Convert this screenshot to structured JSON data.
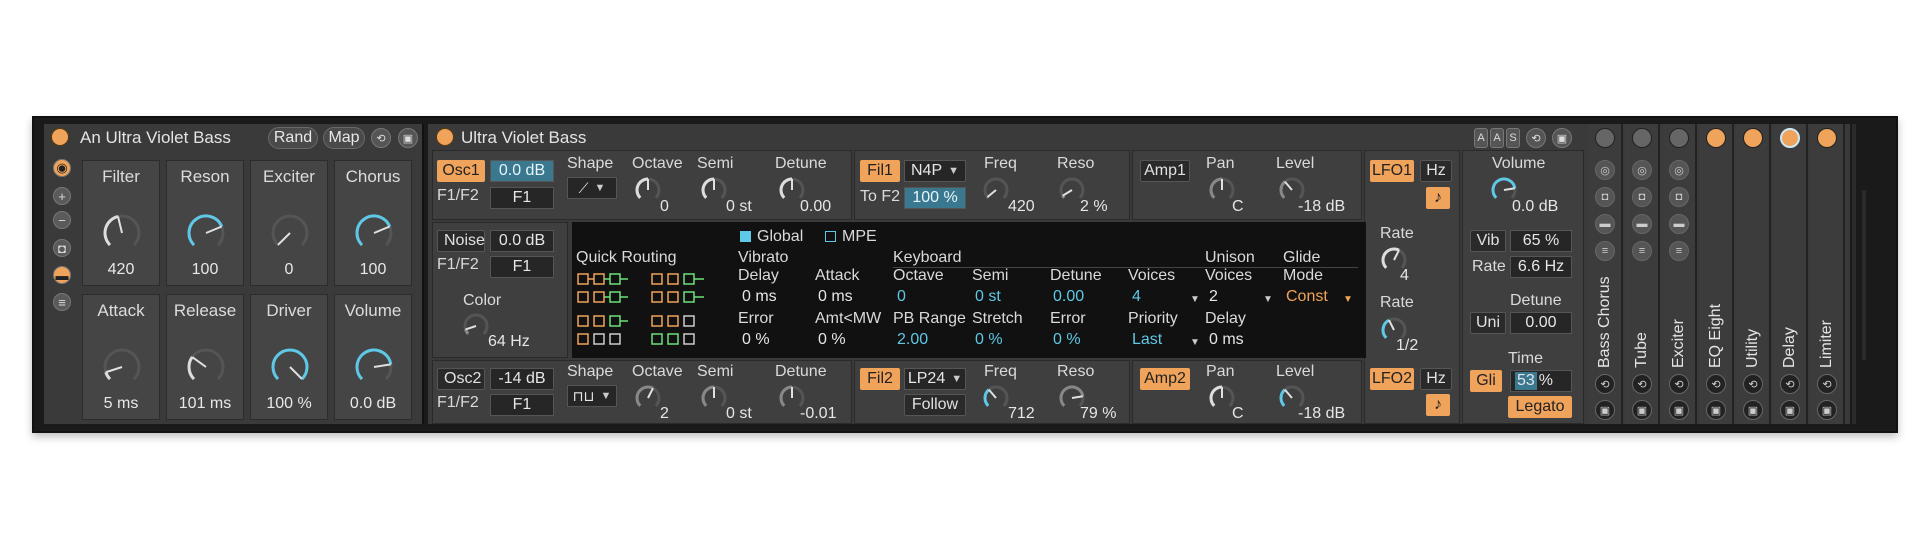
{
  "rack": {
    "title": "An Ultra Violet Bass",
    "rand_label": "Rand",
    "map_label": "Map",
    "macros": [
      {
        "label": "Filter",
        "value": "420",
        "level": 0.45,
        "color": "#dddddd"
      },
      {
        "label": "Reson",
        "value": "100",
        "level": 0.75,
        "color": "#5ec8e6"
      },
      {
        "label": "Exciter",
        "value": "0",
        "level": 0.0,
        "color": "#dddddd"
      },
      {
        "label": "Chorus",
        "value": "100",
        "level": 0.75,
        "color": "#5ec8e6"
      },
      {
        "label": "Attack",
        "value": "5 ms",
        "level": 0.1,
        "color": "#dddddd"
      },
      {
        "label": "Release",
        "value": "101 ms",
        "level": 0.3,
        "color": "#dddddd"
      },
      {
        "label": "Driver",
        "value": "100 %",
        "level": 1.0,
        "color": "#5ec8e6"
      },
      {
        "label": "Volume",
        "value": "0.0 dB",
        "level": 0.8,
        "color": "#5ec8e6"
      }
    ]
  },
  "synth": {
    "title": "Ultra Violet Bass",
    "header_icons": [
      "A",
      "A",
      "S"
    ],
    "osc1": {
      "label": "Osc1",
      "level": "0.0 dB",
      "f1f2_label": "F1/F2",
      "f1f2_value": "F1",
      "shape_label": "Shape",
      "octave_label": "Octave",
      "octave_value": "0",
      "semi_label": "Semi",
      "semi_value": "0 st",
      "detune_label": "Detune",
      "detune_value": "0.00"
    },
    "noise": {
      "label": "Noise",
      "level": "0.0 dB",
      "f1f2_label": "F1/F2",
      "f1f2_value": "F1",
      "color_label": "Color",
      "color_value": "64 Hz"
    },
    "osc2": {
      "label": "Osc2",
      "level": "-14 dB",
      "f1f2_label": "F1/F2",
      "f1f2_value": "F1",
      "shape_label": "Shape",
      "octave_label": "Octave",
      "octave_value": "2",
      "semi_label": "Semi",
      "semi_value": "0 st",
      "detune_label": "Detune",
      "detune_value": "-0.01"
    },
    "fil1": {
      "label": "Fil1",
      "type": "N4P",
      "freq_label": "Freq",
      "freq_value": "420",
      "reso_label": "Reso",
      "reso_value": "2 %",
      "tof2_label": "To F2",
      "tof2_value": "100 %"
    },
    "fil2": {
      "label": "Fil2",
      "type": "LP24",
      "follow_label": "Follow",
      "freq_label": "Freq",
      "freq_value": "712",
      "reso_label": "Reso",
      "reso_value": "79 %"
    },
    "amp1": {
      "label": "Amp1",
      "pan_label": "Pan",
      "pan_value": "C",
      "level_label": "Level",
      "level_value": "-18 dB"
    },
    "amp2": {
      "label": "Amp2",
      "pan_label": "Pan",
      "pan_value": "C",
      "level_label": "Level",
      "level_value": "-18 dB"
    },
    "lfo1": {
      "label": "LFO1",
      "unit": "Hz",
      "rate_label": "Rate",
      "rate_value": "4"
    },
    "lfo2": {
      "label": "LFO2",
      "unit": "Hz",
      "rate_label": "Rate",
      "rate_value": "1/2"
    },
    "note_icon": "♪",
    "mod": {
      "global_label": "Global",
      "mpe_label": "MPE",
      "quick_routing_label": "Quick Routing",
      "vibrato_label": "Vibrato",
      "keyboard_label": "Keyboard",
      "delay_label": "Delay",
      "delay_value": "0 ms",
      "attack_label": "Attack",
      "attack_value": "0 ms",
      "error_label": "Error",
      "error_value": "0 %",
      "amtmw_label": "Amt<MW",
      "amtmw_value": "0 %",
      "octave_label": "Octave",
      "octave_value": "0",
      "semi_label": "Semi",
      "semi_value": "0 st",
      "detune_label": "Detune",
      "detune_value": "0.00",
      "voices_label": "Voices",
      "voices_value": "4",
      "pbrange_label": "PB Range",
      "pbrange_value": "2.00",
      "stretch_label": "Stretch",
      "stretch_value": "0 %",
      "kerror_label": "Error",
      "kerror_value": "0 %",
      "priority_label": "Priority",
      "priority_value": "Last",
      "unison_label": "Unison",
      "unison_voices_label": "Voices",
      "unison_voices_value": "2",
      "unison_delay_label": "Delay",
      "unison_delay_value": "0 ms",
      "glide_label": "Glide",
      "glide_mode_label": "Mode",
      "glide_mode_value": "Const"
    },
    "global": {
      "volume_label": "Volume",
      "volume_value": "0.0 dB",
      "vib_label": "Vib",
      "vib_value": "65 %",
      "rate_label": "Rate",
      "rate_value": "6.6 Hz",
      "uni_label": "Uni",
      "detune_label": "Detune",
      "detune_value": "0.00",
      "gli_label": "Gli",
      "time_label": "Time",
      "time_value": "53",
      "time_unit": "%",
      "legato_label": "Legato"
    }
  },
  "chain": [
    "Bass Chorus",
    "Tube",
    "Exciter",
    "EQ Eight",
    "Utility",
    "Delay",
    "Limiter"
  ],
  "colors": {
    "accent": "#f0a35a",
    "cyan": "#5ec8e6",
    "panel": "#3a3a3a"
  }
}
